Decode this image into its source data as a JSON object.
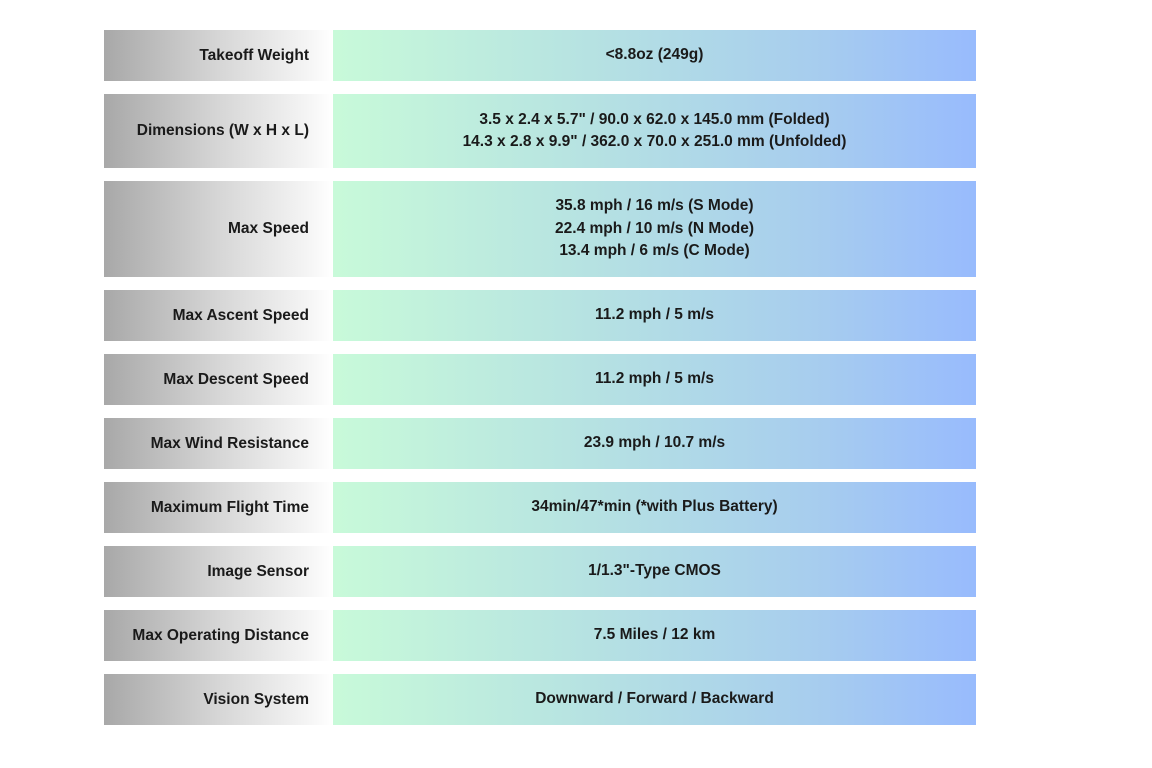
{
  "specs": [
    {
      "label": "Takeoff Weight",
      "values": [
        "<8.8oz (249g)"
      ]
    },
    {
      "label": "Dimensions (W x H x L)",
      "values": [
        "3.5 x 2.4 x 5.7\" / 90.0 x 62.0 x 145.0 mm (Folded)",
        "14.3 x 2.8 x 9.9\" / 362.0 x 70.0 x 251.0 mm (Unfolded)"
      ]
    },
    {
      "label": "Max Speed",
      "values": [
        "35.8 mph / 16 m/s (S Mode)",
        "22.4 mph / 10 m/s (N Mode)",
        "13.4 mph / 6 m/s (C Mode)"
      ]
    },
    {
      "label": "Max Ascent Speed",
      "values": [
        "11.2 mph / 5 m/s"
      ]
    },
    {
      "label": "Max Descent Speed",
      "values": [
        "11.2 mph / 5 m/s"
      ]
    },
    {
      "label": "Max Wind Resistance",
      "values": [
        "23.9 mph / 10.7 m/s"
      ]
    },
    {
      "label": "Maximum Flight Time",
      "values": [
        "34min/47*min (*with Plus Battery)"
      ]
    },
    {
      "label": "Image Sensor",
      "values": [
        "1/1.3\"-Type CMOS"
      ]
    },
    {
      "label": "Max Operating Distance",
      "values": [
        "7.5 Miles / 12 km"
      ]
    },
    {
      "label": "Vision System",
      "values": [
        "Downward / Forward / Backward"
      ]
    }
  ],
  "colors": {
    "label_gradient_start": "#a8a8a8",
    "label_gradient_end": "#ffffff",
    "value_gradient_start": "#c8fad9",
    "value_gradient_end": "#98bbfd"
  }
}
